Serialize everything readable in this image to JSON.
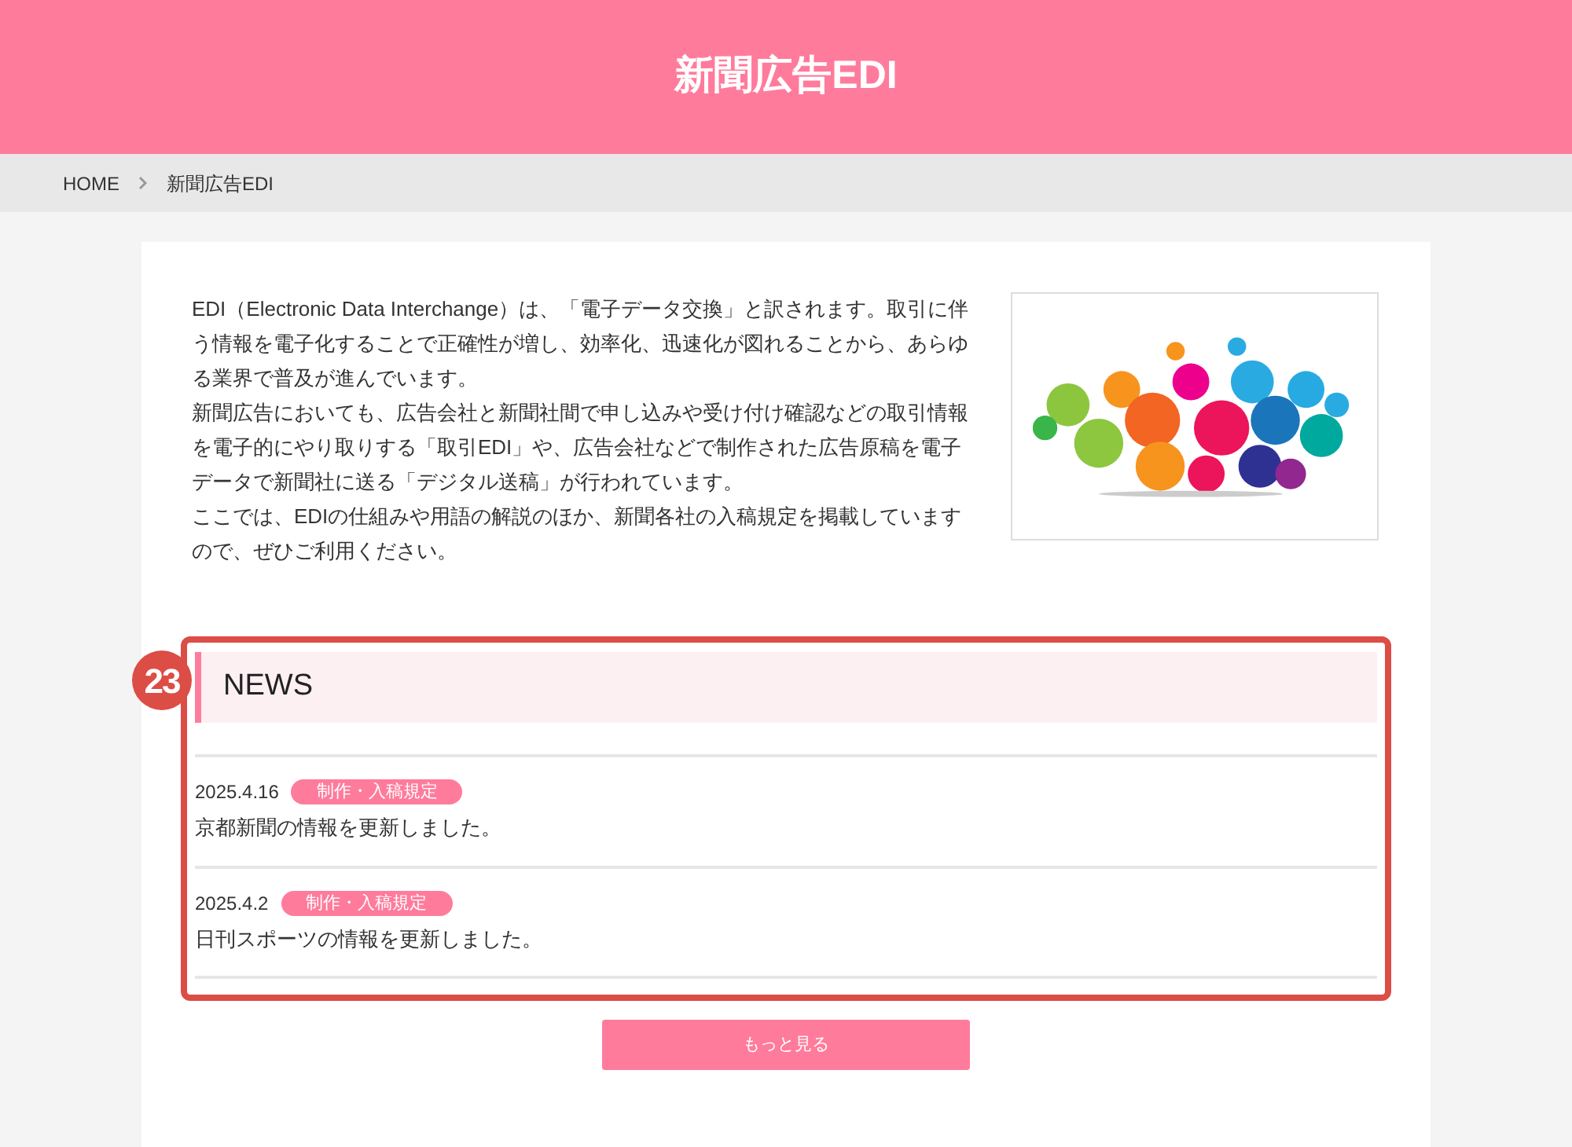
{
  "header": {
    "title": "新聞広告EDI"
  },
  "breadcrumb": [
    {
      "label": "HOME"
    },
    {
      "label": "新聞広告EDI"
    }
  ],
  "intro": {
    "paragraphs": [
      "EDI（Electronic Data Interchange）は、「電子データ交換」と訳されます。取引に伴う情報を電子化することで正確性が増し、効率化、迅速化が図れることから、あらゆる業界で普及が進んでいます。",
      "新聞広告においても、広告会社と新聞社間で申し込みや受け付け確認などの取引情報を電子的にやり取りする「取引EDI」や、広告会社などで制作された広告原稿を電子データで新聞社に送る「デジタル送稿」が行われています。",
      "ここでは、EDIの仕組みや用語の解説のほか、新聞各社の入稿規定を掲載していますので、ぜひご利用ください。"
    ]
  },
  "annotation": {
    "number": "23"
  },
  "news": {
    "title": "NEWS",
    "items": [
      {
        "date": "2025.4.16",
        "tag": "制作・入稿規定",
        "text": "京都新聞の情報を更新しました。"
      },
      {
        "date": "2025.4.2",
        "tag": "制作・入稿規定",
        "text": "日刊スポーツの情報を更新しました。"
      }
    ],
    "more_button": "もっと見る"
  }
}
